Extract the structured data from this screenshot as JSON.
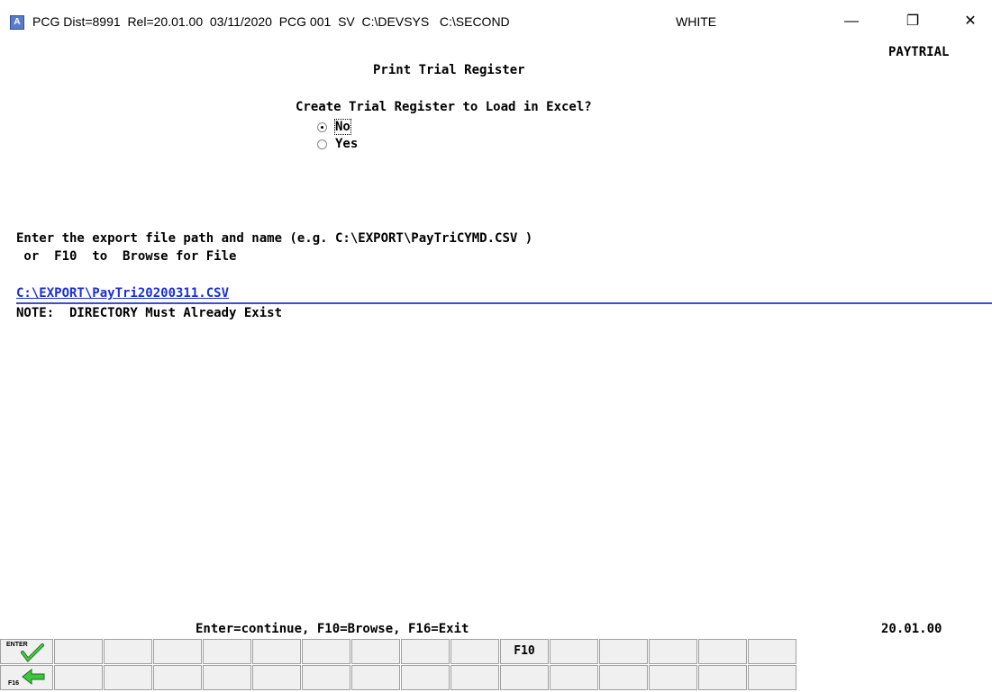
{
  "window": {
    "title": "PCG Dist=8991  Rel=20.01.00  03/11/2020  PCG 001  SV  C:\\DEVSYS   C:\\SECOND",
    "session": "WHITE",
    "app_icon": "A"
  },
  "screen": {
    "program_id": "PAYTRIAL",
    "title": "Print Trial Register",
    "question": "Create Trial Register to Load in Excel?",
    "options": [
      {
        "label": "No",
        "selected": true
      },
      {
        "label": "Yes",
        "selected": false
      }
    ],
    "instruction_line1": "Enter the export file path and name (e.g. C:\\EXPORT\\PayTriCYMD.CSV )",
    "instruction_line2": " or  F10  to  Browse for File",
    "file_path": "C:\\EXPORT\\PayTri20200311.CSV",
    "note": "NOTE:  DIRECTORY Must Already Exist"
  },
  "footer": {
    "status": "Enter=continue, F10=Browse, F16=Exit",
    "version": "20.01.00"
  },
  "fkeys": {
    "enter_label": "ENTER",
    "f16_label": "F16",
    "f10_label": "F10",
    "enter_icon": "green-checkmark-icon",
    "f16_icon": "green-back-arrow-icon"
  }
}
